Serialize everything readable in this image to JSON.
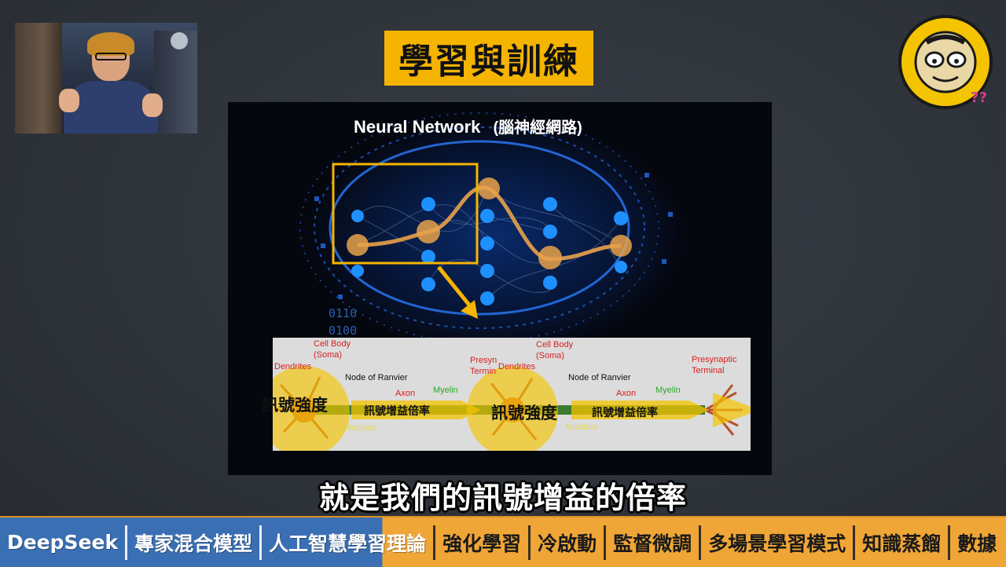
{
  "slide_title": "學習與訓練",
  "slide": {
    "heading": "Neural Network",
    "heading_cn": "(腦神經網路)",
    "binary_a": "0110",
    "binary_b": "0100",
    "neuron_labels": {
      "cell_body_1": "Cell Body",
      "soma_1": "(Soma)",
      "dendrites_1": "Dendrites",
      "node_ranvier_1": "Node of Ranvier",
      "axon_1": "Axon",
      "myelin_1": "Myelin",
      "presyn_1a": "Presyn",
      "presyn_1b": "Termin",
      "cell_body_2": "Cell Body",
      "soma_2": "(Soma)",
      "dendrites_2": "Dendrites",
      "node_ranvier_2": "Node of Ranvier",
      "axon_2": "Axon",
      "myelin_2": "Myelin",
      "presyn_2a": "Presynaptic",
      "presyn_2b": "Terminal",
      "nucleus_1": "Nucleus",
      "nucleus_2": "Nucleus"
    },
    "overlay": {
      "signal_strength_1": "訊號強度",
      "gain_ratio_1": "訊號增益倍率",
      "signal_strength_2": "訊號強度",
      "gain_ratio_2": "訊號增益倍率"
    }
  },
  "caption": "就是我們的訊號增益的倍率",
  "tags": [
    "DeepSeek",
    "專家混合模型",
    "人工智慧學習理論",
    "強化學習",
    "冷啟動",
    "監督微調",
    "多場景學習模式",
    "知識蒸餾",
    "數據"
  ],
  "colors": {
    "accent_yellow": "#f5b400",
    "tag_blue": "#3a6fb4",
    "tag_orange": "#f0a636",
    "node_blue": "#1e90ff",
    "node_orange": "#e8a24a"
  }
}
